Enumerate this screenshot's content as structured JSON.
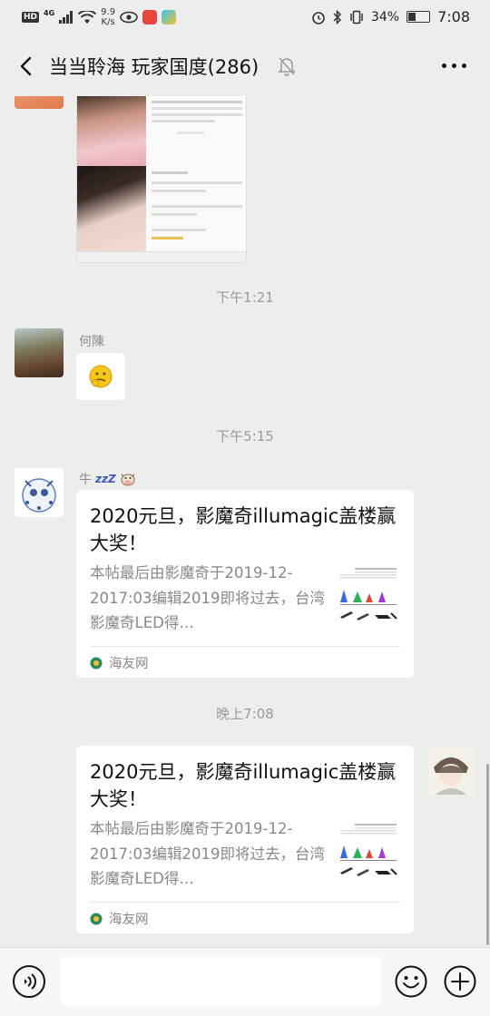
{
  "status_bar": {
    "hd": "HD",
    "network": "4G",
    "speed_value": "9.9",
    "speed_unit": "K/s",
    "battery": "34%",
    "time": "7:08"
  },
  "header": {
    "title": "当当聆海 玩家国度(286)"
  },
  "messages": {
    "ts1": "下午1:21",
    "sender_hechen": "何陳",
    "ts2": "下午5:15",
    "sender_niu": "牛",
    "sender_niu_suffix": "zzZ",
    "ts3": "晚上7:08"
  },
  "link_card_incoming": {
    "title": "2020元旦，影魔奇illumagic盖楼赢大奖！",
    "desc": "本帖最后由影魔奇于2019-12-2017:03编辑2019即将过去，台湾影魔奇LED得…",
    "source": "海友网"
  },
  "link_card_outgoing": {
    "title": "2020元旦，影魔奇illumagic盖楼赢大奖！",
    "desc": "本帖最后由影魔奇于2019-12-2017:03编辑2019即将过去，台湾影魔奇LED得…",
    "source": "海友网"
  },
  "colors": {
    "background": "#ededed",
    "card": "#ffffff",
    "timestamp": "#9a9a9a",
    "source_icon": "#2a8b5a"
  },
  "icons": [
    "back-arrow-icon",
    "mute-bell-icon",
    "more-icon",
    "voice-icon",
    "emoji-icon",
    "plus-icon",
    "thinking-emoji-icon",
    "source-logo-icon"
  ]
}
